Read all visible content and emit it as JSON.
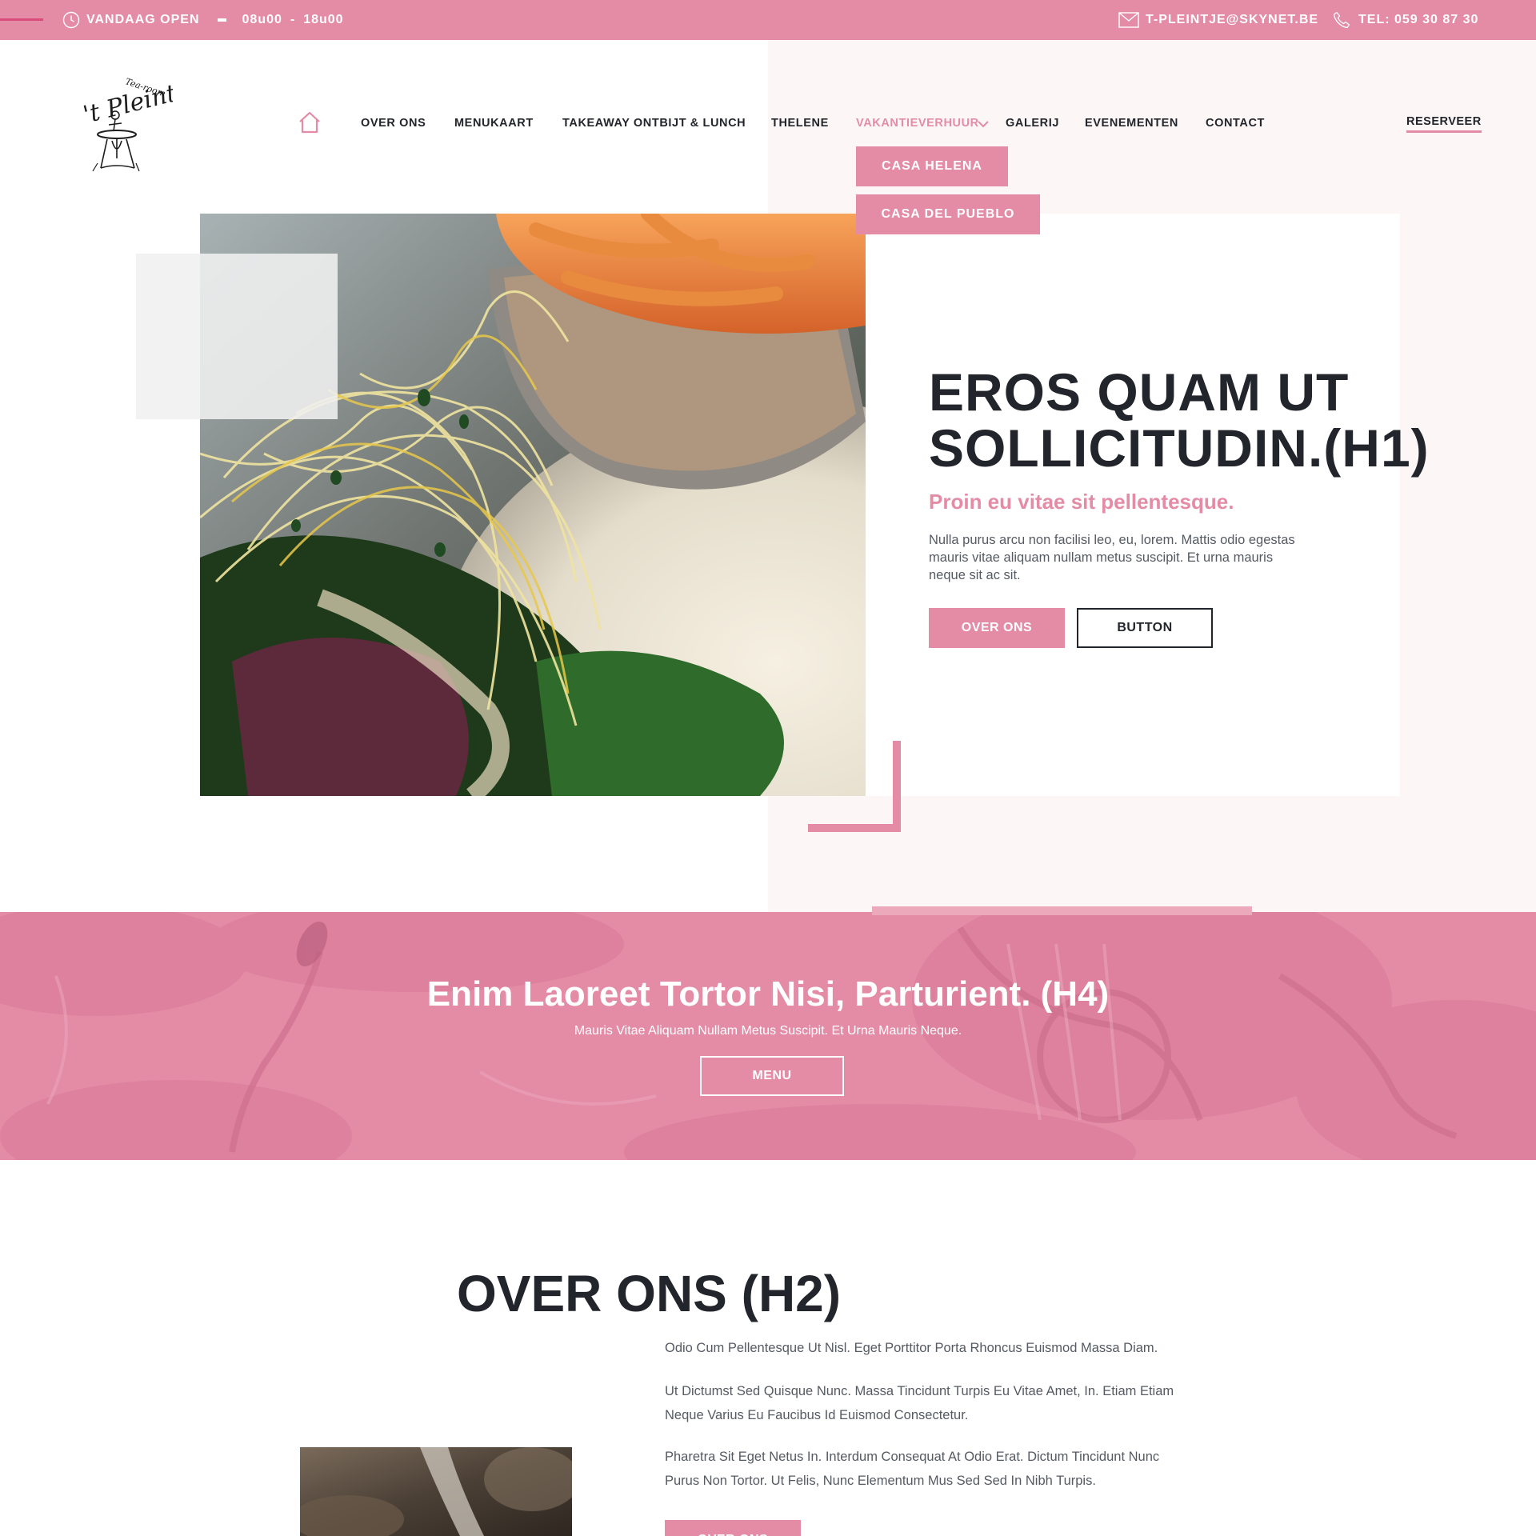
{
  "topbar": {
    "open_label": "VANDAAG OPEN",
    "hours_from": "08u00",
    "hours_sep": "-",
    "hours_to": "18u00",
    "email": "T-PLEINTJE@SKYNET.BE",
    "phone": "TEL: 059 30 87 30"
  },
  "logo": {
    "script_text": "'t Pleintje",
    "tagline": "Tea-room"
  },
  "nav": {
    "items": [
      "OVER ONS",
      "MENUKAART",
      "TAKEAWAY ONTBIJT & LUNCH",
      "THELENE",
      "VAKANTIEVERHUUR",
      "GALERIJ",
      "EVENEMENTEN",
      "CONTACT"
    ],
    "active": "VAKANTIEVERHUUR",
    "reserve_label": "RESERVEER",
    "dropdown": [
      "CASA HELENA",
      "CASA DEL PUEBLO"
    ]
  },
  "hero": {
    "title": "EROS QUAM UT SOLLICITUDIN.(H1)",
    "subtitle": "Proin eu vitae sit pellentesque.",
    "text": "Nulla purus arcu non facilisi leo, eu, lorem. Mattis odio egestas mauris vitae aliquam nullam metus suscipit. Et urna mauris neque sit ac sit.",
    "primary_button": "OVER ONS",
    "secondary_button": "BUTTON"
  },
  "banner": {
    "title": "Enim Laoreet Tortor Nisi, Parturient. (H4)",
    "text": "Mauris Vitae Aliquam Nullam Metus Suscipit. Et Urna Mauris Neque.",
    "button": "MENU"
  },
  "about": {
    "title": "OVER ONS (H2)",
    "paragraphs": [
      "Odio Cum Pellentesque Ut Nisl. Eget Porttitor Porta Rhoncus Euismod Massa Diam.",
      "Ut Dictumst Sed Quisque Nunc. Massa Tincidunt Turpis Eu Vitae Amet, In. Etiam Etiam Neque Varius Eu Faucibus Id Euismod Consectetur.",
      "Pharetra Sit Eget Netus In. Interdum Consequat At Odio Erat. Dictum Tincidunt Nunc Purus Non Tortor. Ut Felis, Nunc Elementum Mus Sed Sed In Nibh Turpis."
    ],
    "button": "OVER ONS"
  },
  "colors": {
    "brand_pink": "#e48ba6",
    "dark_text": "#22252b",
    "body_text": "#555a63",
    "hero_right_bg": "#fcf7f6"
  },
  "icons": {
    "hours": "clock-icon",
    "email": "mail-icon",
    "phone": "phone-icon",
    "home": "home-icon",
    "dropdown": "chevron-down-icon"
  }
}
